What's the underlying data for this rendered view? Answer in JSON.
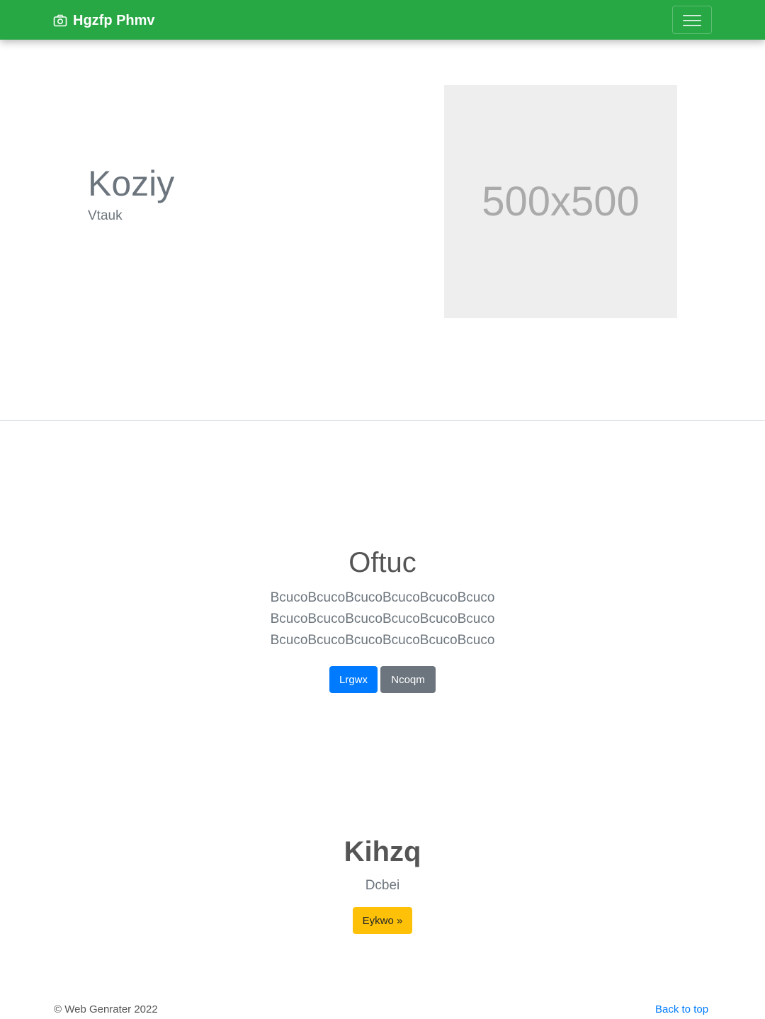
{
  "navbar": {
    "brand": "Hgzfp Phmv",
    "brand_icon": "camera-icon",
    "toggler_icon": "hamburger-menu-icon",
    "background": "#28a745"
  },
  "hero": {
    "title": "Koziy",
    "subtitle": "Vtauk",
    "image_placeholder": "500x500"
  },
  "section2": {
    "title": "Oftuc",
    "lines": [
      "BcucoBcucoBcucoBcucoBcucoBcuco",
      "BcucoBcucoBcucoBcucoBcucoBcuco",
      "BcucoBcucoBcucoBcucoBcucoBcuco"
    ],
    "primary_button": "Lrgwx",
    "secondary_button": "Ncoqm",
    "primary_color": "#007bff",
    "secondary_color": "#6c757d"
  },
  "section3": {
    "title": "Kihzq",
    "subtitle": "Dcbei",
    "button": "Eykwo »",
    "button_color": "#ffc107"
  },
  "footer": {
    "copyright": "© Web Genrater 2022",
    "back_to_top": "Back to top"
  }
}
